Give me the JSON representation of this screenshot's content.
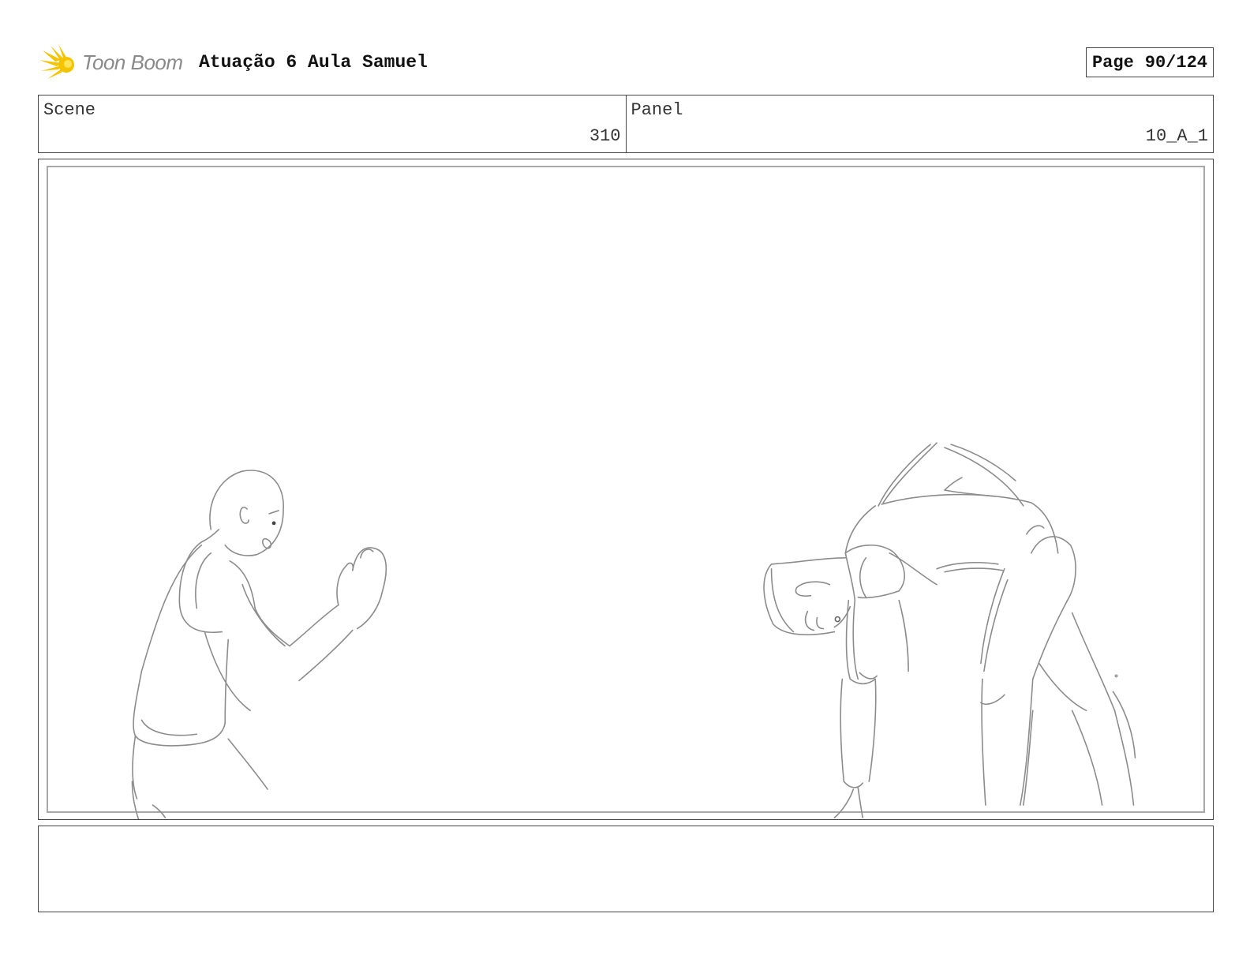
{
  "header": {
    "logo_text": "Toon Boom",
    "project_title": "Atuação 6 Aula Samuel",
    "page_label": "Page",
    "page_value": "90/124"
  },
  "info": {
    "scene_label": "Scene",
    "scene_value": "310",
    "panel_label": "Panel",
    "panel_value": "10_A_1"
  },
  "colors": {
    "logo_star": "#f5c400",
    "logo_text": "#8a8a8a",
    "sketch_stroke": "#8c8c8c"
  }
}
